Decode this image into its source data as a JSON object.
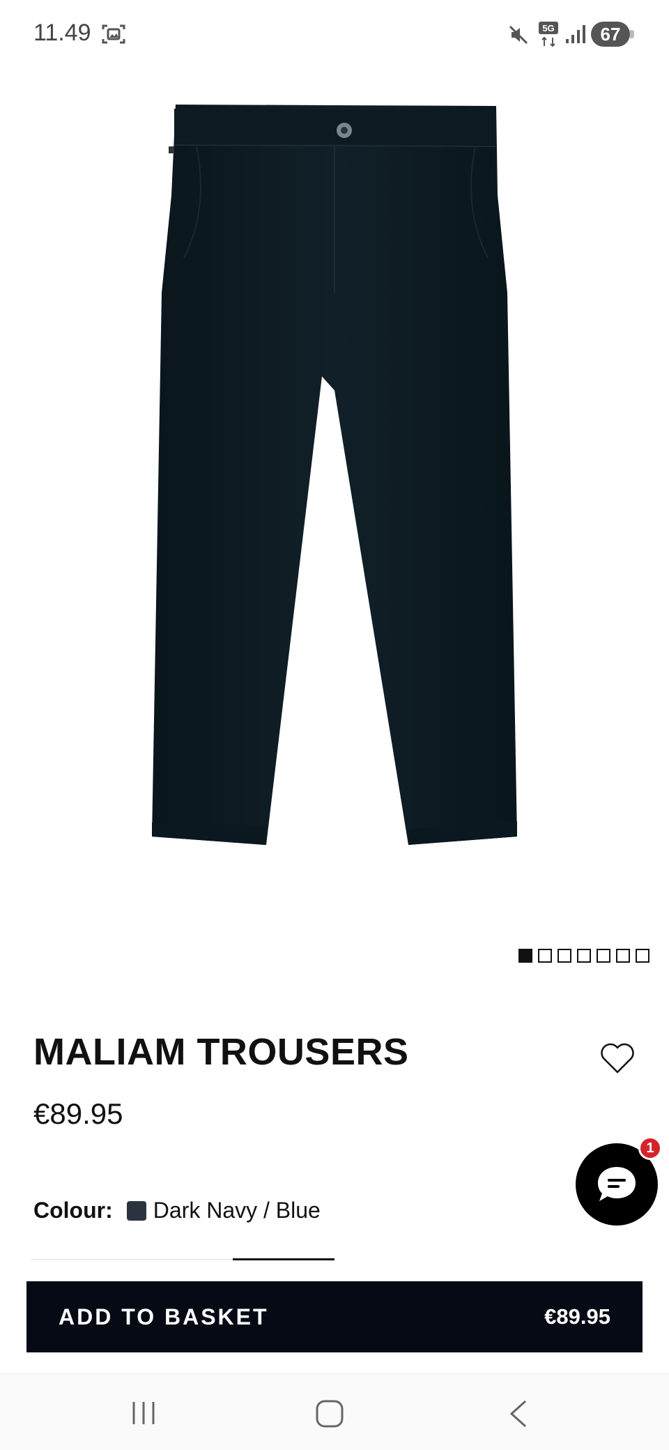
{
  "status_bar": {
    "time": "11.49",
    "battery": "67",
    "network": "5G",
    "icons": [
      "screenshot-icon",
      "mute-icon",
      "signal-icon"
    ]
  },
  "product": {
    "image_alt": "trousers-image",
    "carousel": {
      "total": 7,
      "active_index": 0
    },
    "title": "MALIAM TROUSERS",
    "price": "€89.95",
    "colour_label": "Colour:",
    "colour_value": "Dark Navy / Blue",
    "colour_swatch": "#2a3340"
  },
  "chat": {
    "badge_count": "1"
  },
  "basket": {
    "label": "ADD TO BASKET",
    "price": "€89.95"
  },
  "colors": {
    "button_bg": "#050a14",
    "badge": "#d3242b",
    "trousers": "#0d1a22"
  }
}
